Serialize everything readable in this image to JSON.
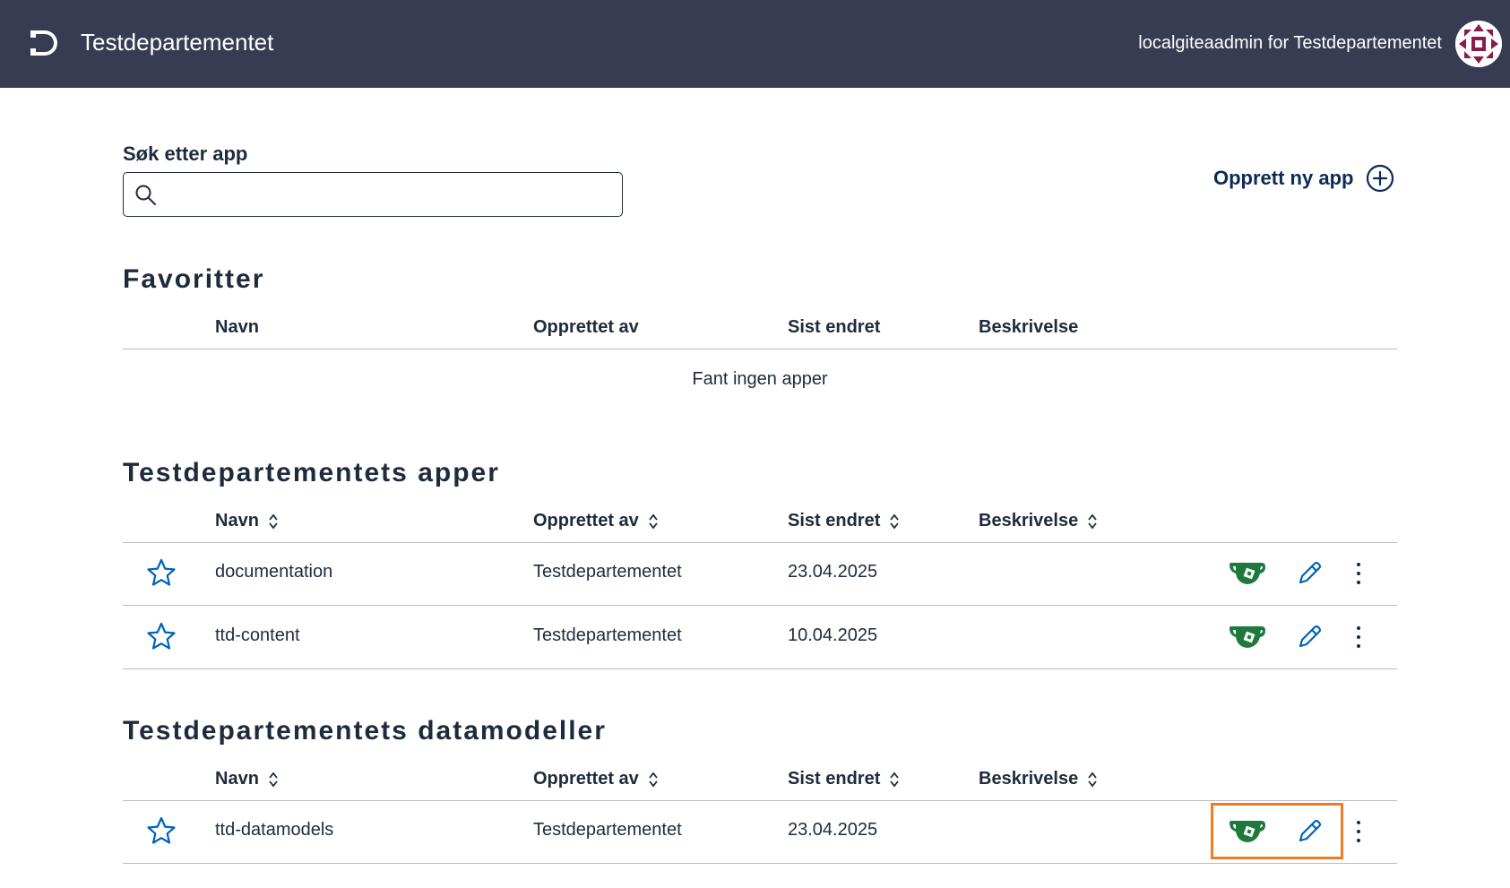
{
  "header": {
    "org_title": "Testdepartementet",
    "user_label": "localgiteaadmin for Testdepartementet"
  },
  "search": {
    "label": "Søk etter app",
    "value": "",
    "placeholder": ""
  },
  "create_app": {
    "label": "Opprett ny app"
  },
  "columns": {
    "name": "Navn",
    "created_by": "Opprettet av",
    "last_changed": "Sist endret",
    "description": "Beskrivelse"
  },
  "favorites": {
    "title": "Favoritter",
    "empty_text": "Fant ingen apper"
  },
  "apps": {
    "title": "Testdepartementets apper",
    "rows": [
      {
        "name": "documentation",
        "created_by": "Testdepartementet",
        "last_changed": "23.04.2025",
        "description": ""
      },
      {
        "name": "ttd-content",
        "created_by": "Testdepartementet",
        "last_changed": "10.04.2025",
        "description": ""
      }
    ]
  },
  "datamodels": {
    "title": "Testdepartementets datamodeller",
    "rows": [
      {
        "name": "ttd-datamodels",
        "created_by": "Testdepartementet",
        "last_changed": "23.04.2025",
        "description": ""
      }
    ]
  },
  "colors": {
    "header_bg": "#383c53",
    "primary": "#0c2a56",
    "star": "#0062ba",
    "gitea_green": "#1e7a3c",
    "highlight": "#f07c22",
    "divider": "#b8bcc4"
  },
  "icons": {
    "logo": "altinn-studio-logo",
    "avatar": "org-avatar",
    "search": "search-icon",
    "create": "plus-circle-icon",
    "sort": "sort-icon",
    "favorite": "star-icon",
    "repo": "gitea-icon",
    "edit": "pencil-icon",
    "menu": "kebab-menu-icon"
  }
}
